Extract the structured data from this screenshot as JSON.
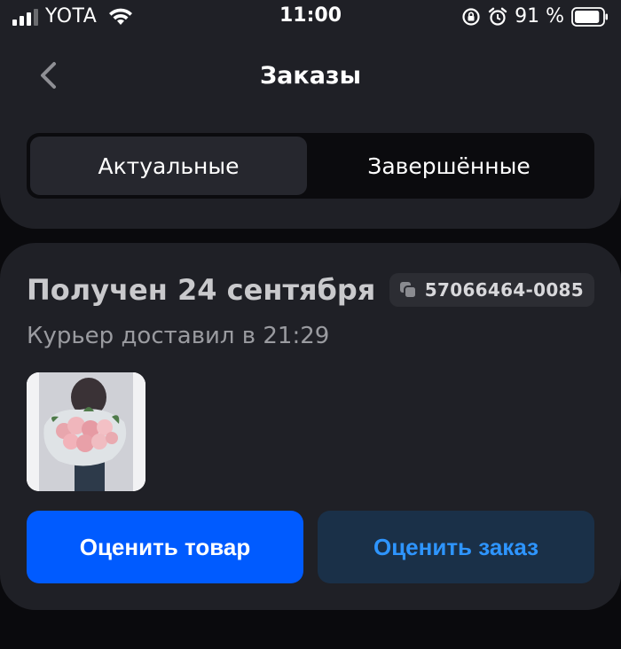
{
  "status_bar": {
    "carrier": "YOTA",
    "time": "11:00",
    "battery": "91 %",
    "battery_level": 0.91
  },
  "nav": {
    "title": "Заказы",
    "back_icon": "chevron-left-icon"
  },
  "tabs": [
    {
      "label": "Актуальные",
      "active": true
    },
    {
      "label": "Завершённые",
      "active": false
    }
  ],
  "order": {
    "title": "Получен 24 сентября",
    "number": "57066464-0085",
    "subtitle": "Курьер доставил в 21:29",
    "thumbnail": "bouquet-of-pink-roses-image",
    "rate_product_label": "Оценить товар",
    "rate_order_label": "Оценить заказ"
  },
  "colors": {
    "accent": "#005bff",
    "secondary_button_bg": "#1a3048",
    "secondary_button_text": "#2e95ff",
    "panel": "#1f2026",
    "background": "#0a0a0d"
  }
}
